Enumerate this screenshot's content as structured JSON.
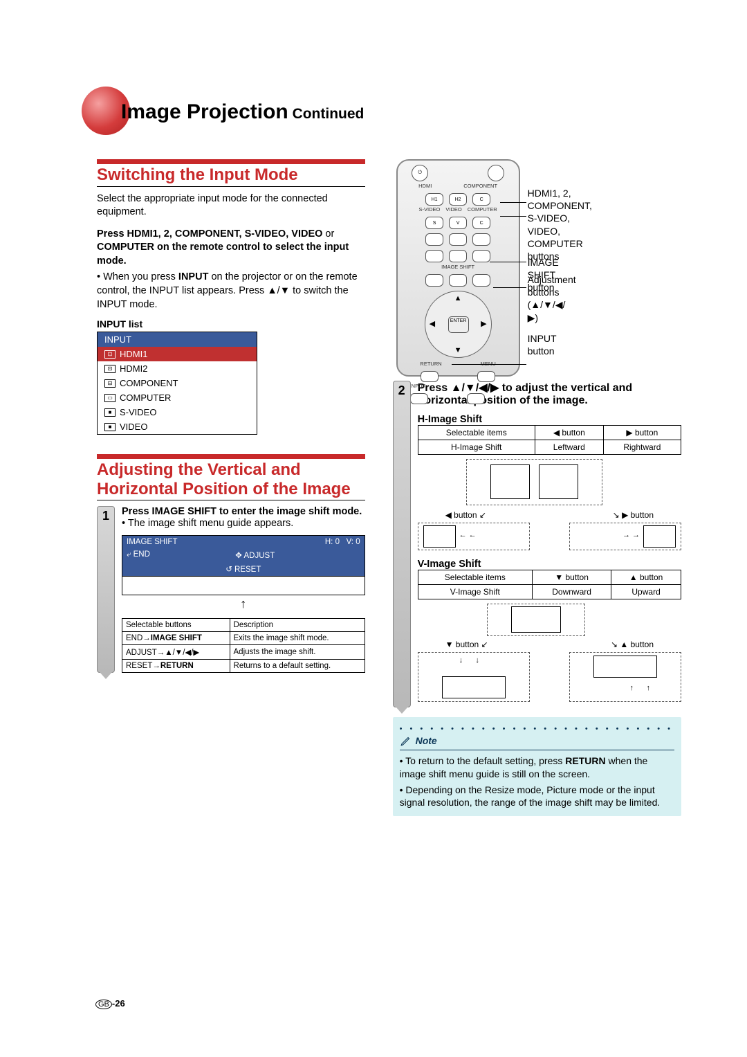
{
  "page": {
    "title_main": "Image Projection",
    "title_cont": " Continued",
    "footer_gb": "GB",
    "footer_num": "-26"
  },
  "section1": {
    "heading": "Switching the Input Mode",
    "intro": "Select the appropriate input mode for the connected equipment.",
    "press_line1": "Press ",
    "press_bold1": "HDMI1",
    "press_text2": ", ",
    "press_bold2": "2",
    "press_text3": ", ",
    "press_bold3": "COMPONENT",
    "press_text4": ", ",
    "press_bold4": "S-VIDEO",
    "press_text5": ", ",
    "press_bold5": "VIDEO",
    "press_text6": " or ",
    "press_bold6": "COMPUTER",
    "press_text7": " on the remote control to select the input mode.",
    "bullet1_a": "When you press ",
    "bullet1_bold": "INPUT",
    "bullet1_b": " on the projector or on the remote control, the INPUT list appears. Press ▲/▼ to switch the INPUT mode.",
    "input_list_label": "INPUT list",
    "input_list": {
      "header": "INPUT",
      "items": [
        "HDMI1",
        "HDMI2",
        "COMPONENT",
        "COMPUTER",
        "S-VIDEO",
        "VIDEO"
      ]
    }
  },
  "section2": {
    "heading": "Adjusting the Vertical and Horizontal Position of the Image",
    "step1_num": "1",
    "step1_a": "Press ",
    "step1_bold": "IMAGE SHIFT",
    "step1_b": " to enter the image shift mode.",
    "step1_bullet": "The image shift menu guide appears.",
    "menu_bar": {
      "title": "IMAGE SHIFT",
      "h": "H: 0",
      "v": "V: 0",
      "end": "⤶ END",
      "adjust": "✥ ADJUST",
      "reset": "↺ RESET"
    },
    "desc_table": {
      "h1": "Selectable buttons",
      "h2": "Description",
      "rows": [
        {
          "a": "END→",
          "a2": "IMAGE SHIFT",
          "b": "Exits the image shift mode."
        },
        {
          "a": "ADJUST→",
          "a2": "▲/▼/◀/▶",
          "b": "Adjusts the image shift."
        },
        {
          "a": "RESET→",
          "a2": "RETURN",
          "b": "Returns to a default setting."
        }
      ]
    }
  },
  "remote": {
    "top_buttons": [
      "H1",
      "H2",
      "C"
    ],
    "top_labels": [
      "HDMI",
      "COMPONENT"
    ],
    "row2_buttons": [
      "S",
      "V",
      "C"
    ],
    "row2_labels": [
      "S-VIDEO",
      "VIDEO",
      "COMPUTER"
    ],
    "enter": "ENTER",
    "image_shift": "IMAGE SHIFT",
    "return": "RETURN",
    "menu": "MENU",
    "input": "INPUT"
  },
  "callouts": {
    "c1": "HDMI1, 2, COMPONENT,\nS-VIDEO, VIDEO, COMPUTER\nbuttons",
    "c2": "IMAGE SHIFT button",
    "c3": "Adjustment buttons\n(▲/▼/◀/▶)",
    "c4": "INPUT button"
  },
  "step2": {
    "num": "2",
    "text_a": "Press ▲/▼/◀/▶ to adjust the vertical and horizontal position of the image.",
    "h_title": "H-Image Shift",
    "h_table": {
      "h1": "Selectable items",
      "h2": "◀ button",
      "h3": "▶ button",
      "r1": "H-Image Shift",
      "r2": "Leftward",
      "r3": "Rightward"
    },
    "h_diag": {
      "left": "◀ button",
      "right": "▶ button"
    },
    "v_title": "V-Image Shift",
    "v_table": {
      "h1": "Selectable items",
      "h2": "▼ button",
      "h3": "▲ button",
      "r1": "V-Image Shift",
      "r2": "Downward",
      "r3": "Upward"
    },
    "v_diag": {
      "left": "▼ button",
      "right": "▲ button"
    }
  },
  "note": {
    "title": "Note",
    "b1_a": "To return to the default setting, press ",
    "b1_bold": "RETURN",
    "b1_b": " when the image shift menu guide is still on the screen.",
    "b2": "Depending on the Resize mode, Picture mode or the input signal resolution, the range of the image shift may be limited."
  }
}
